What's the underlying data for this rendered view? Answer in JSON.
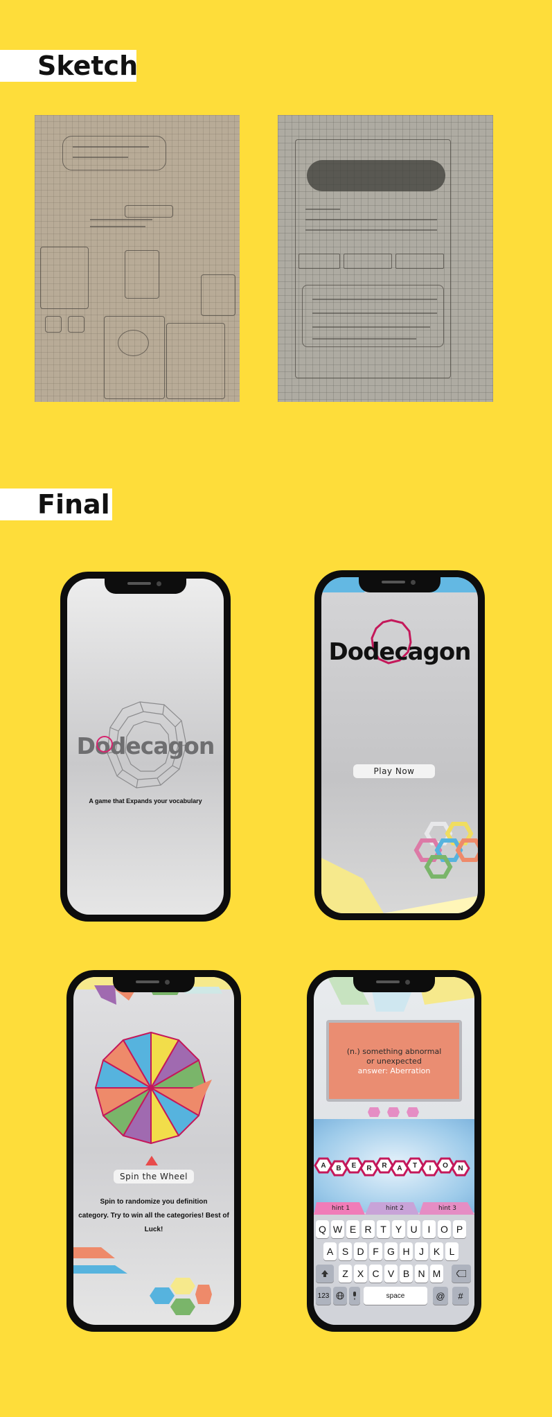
{
  "sections": {
    "sketch_label": "Sketch",
    "final_label": "Final"
  },
  "screens": {
    "splash": {
      "logo": "Dodecagon",
      "tagline": "A game that Expands your vocabulary"
    },
    "home": {
      "logo": "Dodecagon",
      "play_button": "Play Now"
    },
    "spin": {
      "spin_button": "Spin the Wheel",
      "description_line1": "Spin to randomize you definition",
      "description_line2": "category. Try to win all the categories! Best of Luck!"
    },
    "word": {
      "definition_line1": "(n.) something abnormal",
      "definition_line2": "or unexpected",
      "answer": "answer: Aberration",
      "letters": [
        "A",
        "B",
        "E",
        "R",
        "R",
        "A",
        "T",
        "I",
        "O",
        "N"
      ],
      "hints": [
        "hint 1",
        "hint 2",
        "hint 3"
      ],
      "keyboard": {
        "row1": [
          "Q",
          "W",
          "E",
          "R",
          "T",
          "Y",
          "U",
          "I",
          "O",
          "P"
        ],
        "row2": [
          "A",
          "S",
          "D",
          "F",
          "G",
          "H",
          "J",
          "K",
          "L"
        ],
        "row3": [
          "Z",
          "X",
          "C",
          "V",
          "B",
          "N",
          "M"
        ],
        "numbers_key": "123",
        "space_key": "space",
        "at_key": "@",
        "hash_key": "#"
      }
    }
  },
  "colors": {
    "background": "#FEDD3A",
    "accent_magenta": "#c4185a",
    "wheel_blue": "#56b3de",
    "wheel_yellow": "#f2dd4a",
    "wheel_purple": "#a06ab0",
    "wheel_green": "#7ab56a",
    "wheel_orange": "#ee8a6a"
  }
}
